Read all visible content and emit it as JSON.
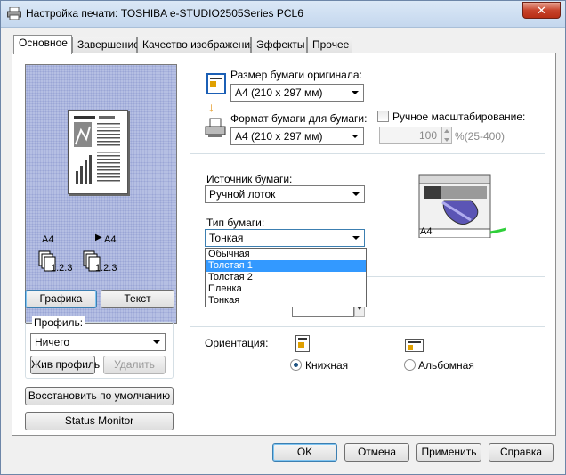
{
  "window": {
    "title": "Настройка печати: TOSHIBA e-STUDIO2505Series PCL6",
    "close": "✕"
  },
  "tabs": [
    {
      "label": "Основное",
      "active": true
    },
    {
      "label": "Завершение"
    },
    {
      "label": "Качество изображения"
    },
    {
      "label": "Эффекты"
    },
    {
      "label": "Прочее"
    }
  ],
  "preview": {
    "paper_left": "A4",
    "paper_right": "A4",
    "copies_left": "1.2.3",
    "copies_right": "1.2.3"
  },
  "preview_buttons": {
    "graphics": "Графика",
    "text": "Текст"
  },
  "profile": {
    "group_label": "Профиль:",
    "selected": "Ничего",
    "live_button": "Жив профиль",
    "delete_button": "Удалить"
  },
  "restore_button": "Восстановить по умолчанию",
  "status_monitor_button": "Status Monitor",
  "paper": {
    "original_size_label": "Размер бумаги оригинала:",
    "original_size_value": "A4 (210 x 297 мм)",
    "print_size_label": "Формат бумаги для бумаги:",
    "print_size_value": "A4 (210 x 297 мм)",
    "manual_scaling_label": "Ручное масштабирование:",
    "scale_value": "100",
    "scale_range": "%(25-400)"
  },
  "source": {
    "label": "Источник бумаги:",
    "value": "Ручной лоток",
    "printer_paper": "A4"
  },
  "paper_type": {
    "label": "Тип бумаги:",
    "value": "Тонкая",
    "options": [
      "Обычная",
      "Толстая 1",
      "Толстая 2",
      "Пленка",
      "Тонкая"
    ],
    "highlighted_index": 1
  },
  "orientation": {
    "label": "Ориентация:",
    "portrait": "Книжная",
    "landscape": "Альбомная",
    "selected": "portrait"
  },
  "footer": {
    "ok": "OK",
    "cancel": "Отмена",
    "apply": "Применить",
    "help": "Справка"
  }
}
